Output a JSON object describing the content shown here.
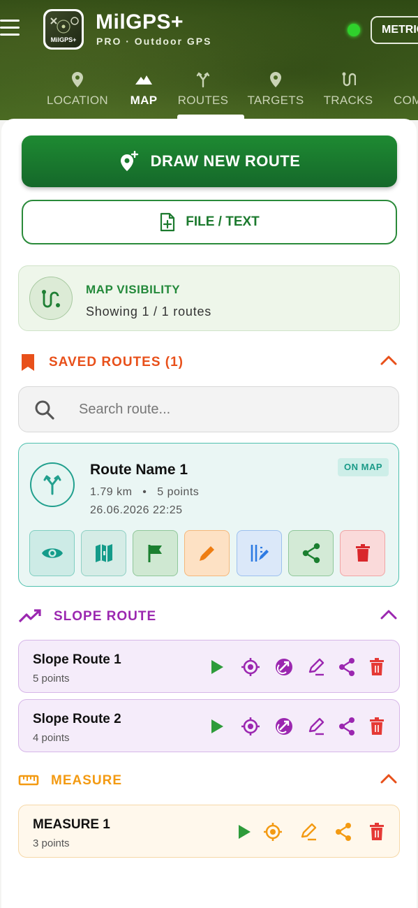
{
  "header": {
    "app_name": "MilGPS+",
    "subtitle": "PRO · Outdoor GPS",
    "logo_text": "MilGPS+",
    "units_button": "METRIC"
  },
  "tabs": [
    {
      "label": "LOCATION",
      "icon": "pin-icon"
    },
    {
      "label": "MAP",
      "icon": "mountain-icon",
      "active": true
    },
    {
      "label": "ROUTES",
      "icon": "fork-icon"
    },
    {
      "label": "TARGETS",
      "icon": "pin-icon"
    },
    {
      "label": "TRACKS",
      "icon": "route-icon"
    },
    {
      "label": "COM",
      "icon": ""
    }
  ],
  "actions": {
    "draw_new_route": "DRAW NEW ROUTE",
    "file_text": "FILE / TEXT"
  },
  "map_visibility": {
    "title": "MAP VISIBILITY",
    "status": "Showing 1  /  1 routes"
  },
  "saved_routes": {
    "title": "SAVED ROUTES (1)",
    "search_placeholder": "Search route...",
    "items": [
      {
        "name": "Route Name 1",
        "distance": "1.79  km",
        "points": "5  points",
        "date": "26.06.2026  22:25",
        "badge": "ON MAP"
      }
    ]
  },
  "slope_route": {
    "title": "SLOPE ROUTE",
    "items": [
      {
        "name": "Slope Route 1",
        "points": "5 points"
      },
      {
        "name": "Slope Route 2",
        "points": "4 points"
      }
    ]
  },
  "measure": {
    "title": "MEASURE",
    "items": [
      {
        "name": "MEASURE 1",
        "points": "3 points"
      }
    ]
  },
  "colors": {
    "green": "#1e8a32",
    "orange_red": "#e8501a",
    "purple": "#9b27b0",
    "amber": "#f39a12",
    "teal": "#22a08e",
    "red": "#e53935"
  }
}
